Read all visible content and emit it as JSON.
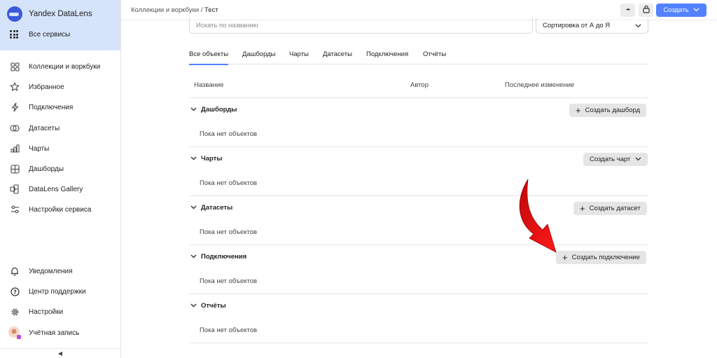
{
  "app": {
    "title": "Yandex DataLens",
    "all_services": "Все сервисы"
  },
  "sidebar": {
    "items": [
      {
        "label": "Коллекции и воркбуки",
        "icon": "collections-icon"
      },
      {
        "label": "Избранное",
        "icon": "star-icon"
      },
      {
        "label": "Подключения",
        "icon": "lightning-icon"
      },
      {
        "label": "Датасеты",
        "icon": "dataset-icon"
      },
      {
        "label": "Чарты",
        "icon": "chart-icon"
      },
      {
        "label": "Дашборды",
        "icon": "dashboard-icon"
      },
      {
        "label": "DataLens Gallery",
        "icon": "gallery-icon"
      },
      {
        "label": "Настройки сервиса",
        "icon": "sliders-icon"
      }
    ],
    "bottom": [
      {
        "label": "Уведомления",
        "icon": "bell-icon"
      },
      {
        "label": "Центр поддержки",
        "icon": "help-icon"
      },
      {
        "label": "Настройки",
        "icon": "gear-icon"
      },
      {
        "label": "Учётная запись",
        "icon": "avatar-icon"
      }
    ],
    "collapse": "◀"
  },
  "header": {
    "breadcrumb_parent": "Коллекции и воркбуки",
    "breadcrumb_sep": " / ",
    "breadcrumb_current": "Тест",
    "more": "•••",
    "create_label": "Создать"
  },
  "search": {
    "placeholder": "Искать по названию"
  },
  "sort": {
    "value": "Сортировка от А до Я"
  },
  "tabs": [
    "Все объекты",
    "Дашборды",
    "Чарты",
    "Датасеты",
    "Подключения",
    "Отчёты"
  ],
  "columns": {
    "name": "Название",
    "author": "Автор",
    "modified": "Последнее изменение"
  },
  "sections": [
    {
      "title": "Дашборды",
      "empty": "Пока нет объектов",
      "action": "Создать дашборд"
    },
    {
      "title": "Чарты",
      "empty": "Пока нет объектов",
      "action": "Создать чарт"
    },
    {
      "title": "Датасеты",
      "empty": "Пока нет объектов",
      "action": "Создать датасет"
    },
    {
      "title": "Подключения",
      "empty": "Пока нет объектов",
      "action": "Создать подключение"
    },
    {
      "title": "Отчёты",
      "empty": "Пока нет объектов",
      "action": ""
    }
  ],
  "colors": {
    "accent": "#5282ff",
    "sidebar_head": "#d6e4fb",
    "arrow": "#e01414"
  }
}
